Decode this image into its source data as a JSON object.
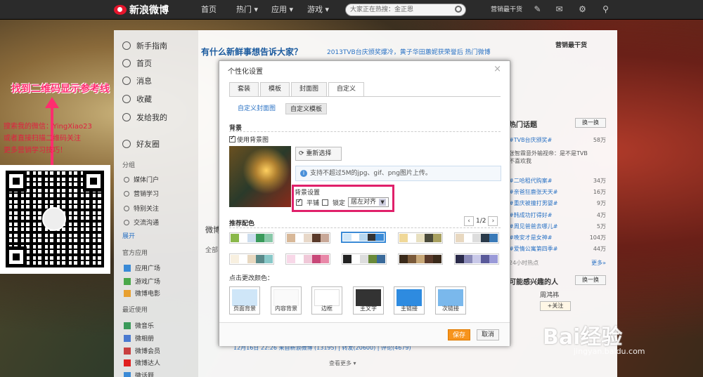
{
  "topbar": {
    "logo": "新浪微博",
    "nav": [
      "首页",
      "热门 ▾",
      "应用 ▾",
      "游戏 ▾"
    ],
    "search_placeholder": "大家正在热搜：金正恩",
    "username": "营销最干货"
  },
  "left_panel": {
    "annotation": "找到二维码显示参考线",
    "red_lines": [
      "搜索我的微信：YingXiao23",
      "或者直接扫描二维码关注",
      "更多营销学习技巧！"
    ]
  },
  "sidebar": {
    "items": [
      "新手指南",
      "首页",
      "消息",
      "收藏",
      "发给我的",
      "好友圈"
    ],
    "group_label": "分组",
    "groups": [
      "媒体门户",
      "营销学习",
      "特别关注",
      "交流沟通"
    ],
    "expand": "展开",
    "apps_label": "官方应用",
    "apps": [
      "应用广场",
      "游戏广场",
      "微博电影"
    ],
    "recent_label": "最近使用",
    "recent": [
      "微音乐",
      "微相册",
      "微博会员",
      "微博达人",
      "微话题"
    ]
  },
  "main": {
    "prompt": "有什么新鲜事想告诉大家？",
    "topic": "2013TVB台庆颁奖爆冷，黄子华田蕙妮获荣誉后 热门微博",
    "feed_label": "微博",
    "all_tab": "全部",
    "more": "查看更多 ▾",
    "stats": "12月16日 22:26 来自新浪微博  (13195) | 转发(20600) | 评论(4679)"
  },
  "dialog": {
    "title": "个性化设置",
    "tabs": [
      "套装",
      "模板",
      "封面图",
      "自定义"
    ],
    "subtabs": [
      "自定义封面图",
      "自定义模板"
    ],
    "bg_section": "背景",
    "use_bg": "使用背景图",
    "reselect": "重新选择",
    "info": "支持不超过5M的jpg、gif、png图片上传。",
    "bg_setting": "背景设置",
    "tile": "平铺",
    "lock": "锁定",
    "align": "居左对齐",
    "color_section": "推荐配色",
    "page": "1/2",
    "change_colors": "点击更改颜色：",
    "color_boxes": [
      "页面背景",
      "内容背景",
      "边框",
      "主文字",
      "主链接",
      "次链接"
    ],
    "save": "保存",
    "cancel": "取消"
  },
  "right": {
    "username": "营销最干货",
    "topics_label": "热门话题",
    "switch": "换一换",
    "topics": [
      {
        "t": "#TVB台庆颁奖#",
        "n": "58万"
      },
      {
        "t": "张智霖意外输视帝：是不是TVB不喜欢我",
        "n": ""
      },
      {
        "t": "#二哈租代购案#",
        "n": "34万"
      },
      {
        "t": "#亲爸狂鹿张天天#",
        "n": "16万"
      },
      {
        "t": "#重庆被撞打男婴#",
        "n": "9万"
      },
      {
        "t": "#韩成功打得好#",
        "n": "4万"
      },
      {
        "t": "#周见爸爸去哪儿#",
        "n": "5万"
      },
      {
        "t": "#晚安才是女神#",
        "n": "104万"
      },
      {
        "t": "#爱情公寓第四季#",
        "n": "44万"
      }
    ],
    "hot24": "24小时热点",
    "more": "更多»",
    "suggest_label": "可能感兴趣的人",
    "suggest": [
      "周鸿祎"
    ],
    "follow": "+关注"
  },
  "watermark": {
    "main": "Bai经验",
    "sub": "jingyan.baidu.com"
  }
}
